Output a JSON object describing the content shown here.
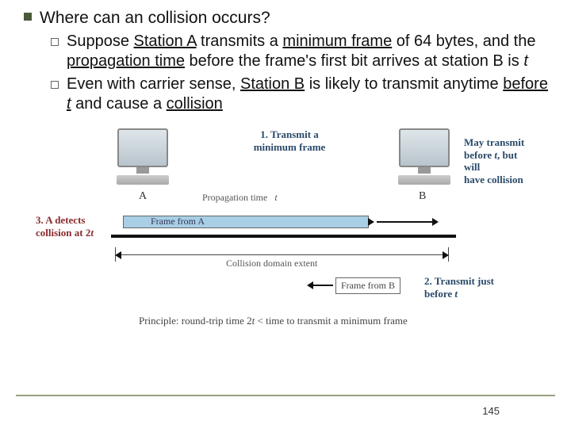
{
  "main": {
    "title": "Where can an collision occurs?",
    "sub1_a": "Suppose ",
    "sub1_b": "Station A",
    "sub1_c": " transmits a ",
    "sub1_d": "minimum frame",
    "sub1_e": " of 64 bytes, and the ",
    "sub1_f": "propagation time",
    "sub1_g": " before the frame's first bit arrives at station B is ",
    "sub1_h": "t",
    "sub2_a": "Even with carrier sense, ",
    "sub2_b": "Station B",
    "sub2_c": " is likely to transmit anytime ",
    "sub2_d": "before ",
    "sub2_e": "t",
    "sub2_f": " and cause a ",
    "sub2_g": "collision"
  },
  "diagram": {
    "caption1a": "1. Transmit a",
    "caption1b": "minimum frame",
    "propagation": "Propagation time",
    "prop_t": "t",
    "stationA": "A",
    "stationB": "B",
    "label3a": "3. A detects",
    "label3b": "collision at 2",
    "label3c": "t",
    "frameA": "Frame from A",
    "extent": "Collision domain extent",
    "frameB": "Frame from B",
    "label2a": "2. Transmit just",
    "label2b": "before ",
    "label2c": "t",
    "right_a": "May transmit",
    "right_b": "before ",
    "right_c": "t",
    "right_d": ", but will",
    "right_e": "have collision",
    "principle_a": "Principle: round-trip time 2",
    "principle_b": "t",
    "principle_c": " < time to transmit a minimum frame"
  },
  "page": "145"
}
